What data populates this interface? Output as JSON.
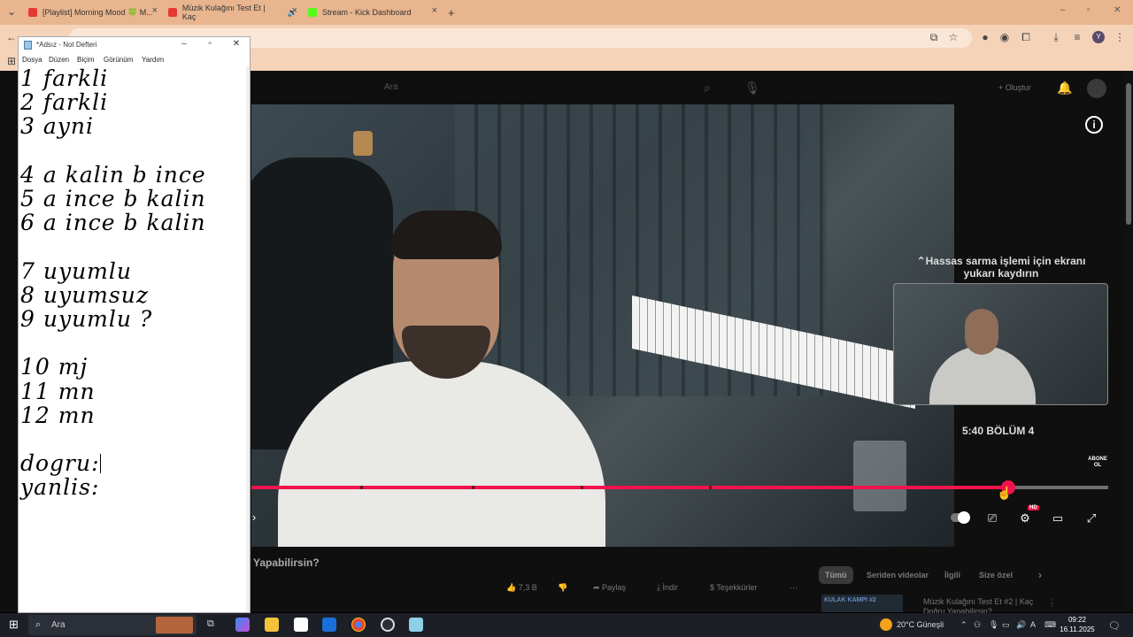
{
  "browser": {
    "tabs": [
      {
        "title": "[Playlist] Morning Mood 🍀 M...",
        "color": "#e53935"
      },
      {
        "title": "Müzik Kulağını Test Et | Kaç",
        "color": "#e53935"
      },
      {
        "title": "Stream - Kick Dashboard",
        "color": "#53fc18"
      }
    ],
    "new_tab": "+"
  },
  "youtube": {
    "search_placeholder": "Ara",
    "create_label": "+ Oluştur",
    "seek_hint": "⌃Hassas sarma işlemi için ekranı yukarı kaydırın",
    "chapter": "5:40  BÖLÜM 4",
    "subscribe_badge": "ABONE OL",
    "hd_badge": "HD",
    "video_title_partial": "Yapabilirsin?",
    "actions": {
      "like": "7,3 B",
      "share": "Paylaş",
      "download": "İndir",
      "thanks": "Teşekkürler"
    },
    "chips": [
      "Tümü",
      "Seriden videolar",
      "İlgili",
      "Size özel"
    ],
    "rec_title": "Müzik Kulağını Test Et #2 | Kaç Doğru Yapabilirsin?",
    "rec_thumb_text": "KULAK KAMPI #2",
    "progress_fraction": 0.883
  },
  "notepad": {
    "title": "*Adsız - Not Defteri",
    "menu": [
      "Dosya",
      "Düzen",
      "Biçim",
      "Görünüm",
      "Yardım"
    ],
    "lines": [
      "1 farkli",
      "2 farkli",
      "3 ayni",
      "",
      "4 a kalin b ince",
      "5 a ince b kalin",
      "6 a ince b kalin",
      "",
      "7 uyumlu",
      "8 uyumsuz",
      "9 uyumlu ?",
      "",
      "10 mj",
      "11 mn",
      "12 mn",
      "",
      "dogru:",
      "yanlis:"
    ]
  },
  "taskbar": {
    "search_placeholder": "Ara",
    "weather": "20°C  Güneşli",
    "time": "09:22",
    "date": "16.11.2025"
  }
}
